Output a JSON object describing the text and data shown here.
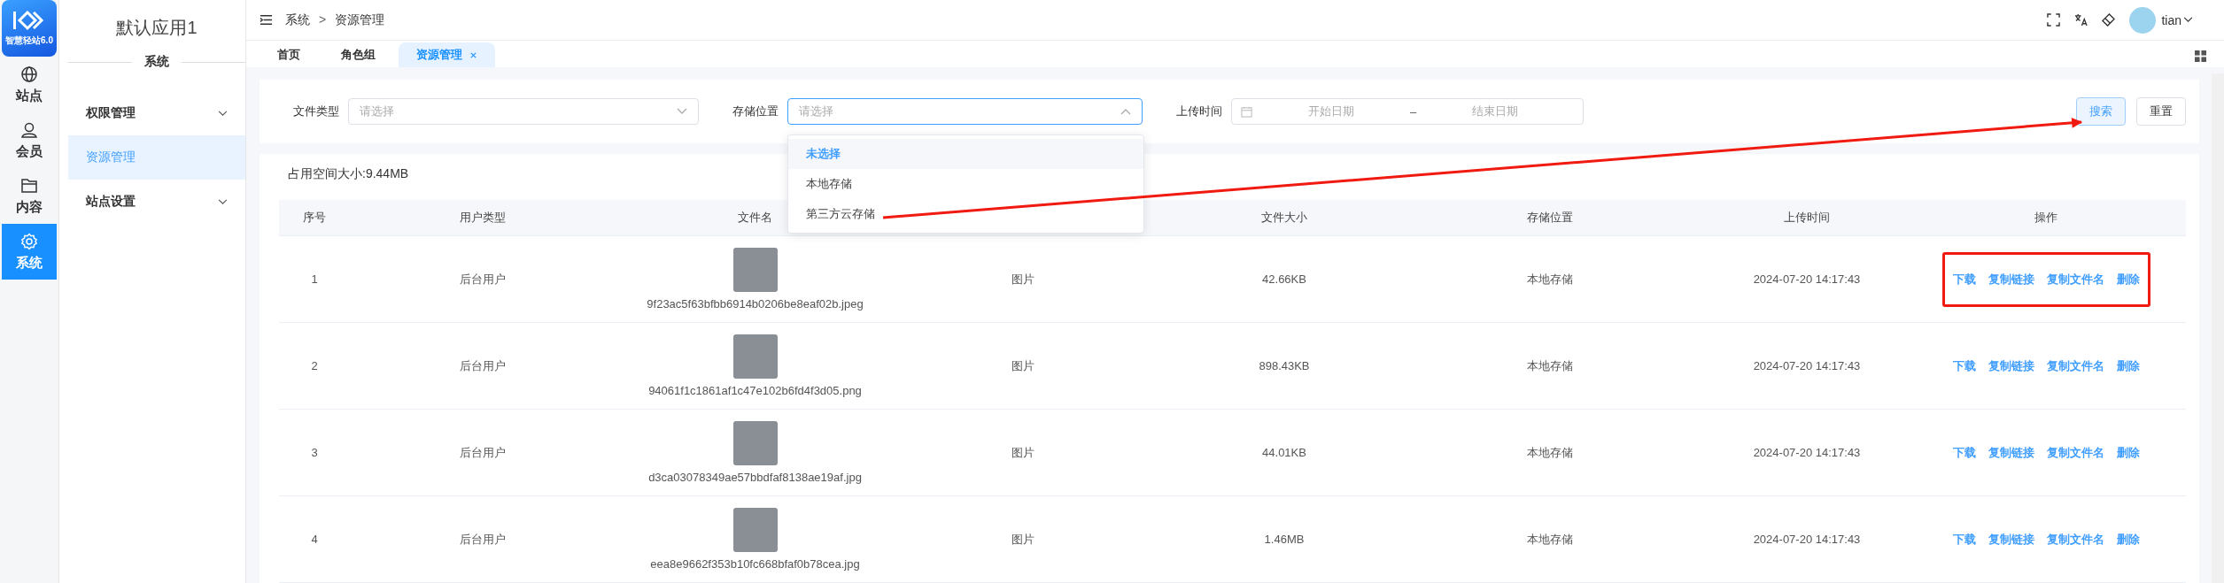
{
  "logo": {
    "text": "智慧轻站6.0"
  },
  "rail": [
    {
      "label": "站点",
      "kind": "globe",
      "selected": false
    },
    {
      "label": "会员",
      "kind": "user",
      "selected": false
    },
    {
      "label": "内容",
      "kind": "folder",
      "selected": false
    },
    {
      "label": "系统",
      "kind": "gear",
      "selected": true
    }
  ],
  "sidebar": {
    "title": "默认应用1",
    "section": "系统",
    "items": [
      {
        "label": "权限管理",
        "expandable": true,
        "selected": false
      },
      {
        "label": "资源管理",
        "expandable": false,
        "selected": true
      },
      {
        "label": "站点设置",
        "expandable": true,
        "selected": false
      }
    ]
  },
  "header": {
    "breadcrumb": [
      "系统",
      "资源管理"
    ],
    "separator": ">",
    "user": "tian"
  },
  "tabs": [
    {
      "label": "首页",
      "selected": false,
      "closable": false
    },
    {
      "label": "角色组",
      "selected": false,
      "closable": false
    },
    {
      "label": "资源管理",
      "selected": true,
      "closable": true
    }
  ],
  "filters": {
    "file_type": {
      "label": "文件类型",
      "placeholder": "请选择",
      "open": false
    },
    "storage": {
      "label": "存储位置",
      "placeholder": "请选择",
      "open": true,
      "options": [
        {
          "label": "未选择",
          "selected": true
        },
        {
          "label": "本地存储",
          "selected": false
        },
        {
          "label": "第三方云存储",
          "selected": false
        }
      ]
    },
    "upload_time": {
      "label": "上传时间",
      "start_placeholder": "开始日期",
      "separator": "–",
      "end_placeholder": "结束日期"
    },
    "buttons": [
      {
        "label": "搜索",
        "kind": "primary"
      },
      {
        "label": "重置",
        "kind": "default"
      }
    ]
  },
  "usage": "占用空间大小:9.44MB",
  "table": {
    "columns": [
      "序号",
      "用户类型",
      "文件名",
      null,
      "文件大小",
      "存储位置",
      "上传时间",
      "操作"
    ],
    "rows": [
      {
        "index": "1",
        "user_type": "后台用户",
        "file_name": "9f23ac5f63bfbb6914b0206be8eaf02b.jpeg",
        "type": "图片",
        "size": "42.66KB",
        "storage": "本地存储",
        "time": "2024-07-20 14:17:43",
        "actions": [
          "下载",
          "复制链接",
          "复制文件名",
          "删除"
        ],
        "highlighted": true
      },
      {
        "index": "2",
        "user_type": "后台用户",
        "file_name": "94061f1c1861af1c47e102b6fd4f3d05.png",
        "type": "图片",
        "size": "898.43KB",
        "storage": "本地存储",
        "time": "2024-07-20 14:17:43",
        "actions": [
          "下载",
          "复制链接",
          "复制文件名",
          "删除"
        ],
        "highlighted": false
      },
      {
        "index": "3",
        "user_type": "后台用户",
        "file_name": "d3ca03078349ae57bbdfaf8138ae19af.jpg",
        "type": "图片",
        "size": "44.01KB",
        "storage": "本地存储",
        "time": "2024-07-20 14:17:43",
        "actions": [
          "下载",
          "复制链接",
          "复制文件名",
          "删除"
        ],
        "highlighted": false
      },
      {
        "index": "4",
        "user_type": "后台用户",
        "file_name": "eea8e9662f353b10fc668bfaf0b78cea.jpg",
        "type": "图片",
        "size": "1.46MB",
        "storage": "本地存储",
        "time": "2024-07-20 14:17:43",
        "actions": [
          "下载",
          "复制链接",
          "复制文件名",
          "删除"
        ],
        "highlighted": false
      }
    ]
  },
  "annotation": {
    "arrow": true
  }
}
